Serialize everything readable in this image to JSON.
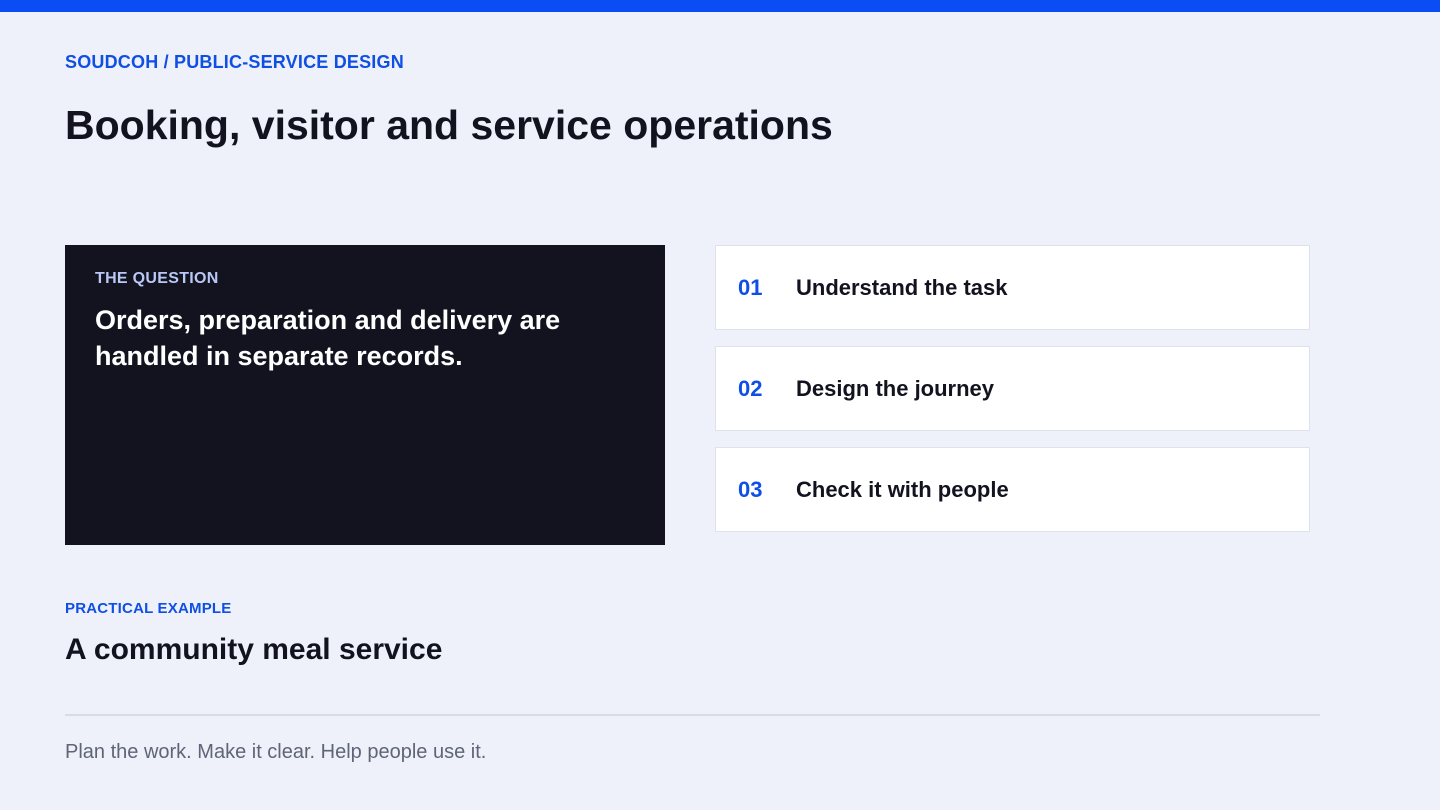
{
  "theme": {
    "accent": "#0b4df5",
    "background": "#eef1f9",
    "dark_panel": "#12131f"
  },
  "header": {
    "breadcrumb": "SOUDCOH / PUBLIC-SERVICE DESIGN",
    "title": "Booking, visitor and service operations"
  },
  "question": {
    "label": "THE QUESTION",
    "text": "Orders, preparation and delivery are handled in separate records."
  },
  "steps": [
    {
      "number": "01",
      "label": "Understand the task"
    },
    {
      "number": "02",
      "label": "Design the journey"
    },
    {
      "number": "03",
      "label": "Check it with people"
    }
  ],
  "example": {
    "label": "PRACTICAL EXAMPLE",
    "title": "A community meal service"
  },
  "footer": {
    "text": "Plan the work. Make it clear. Help people use it."
  }
}
